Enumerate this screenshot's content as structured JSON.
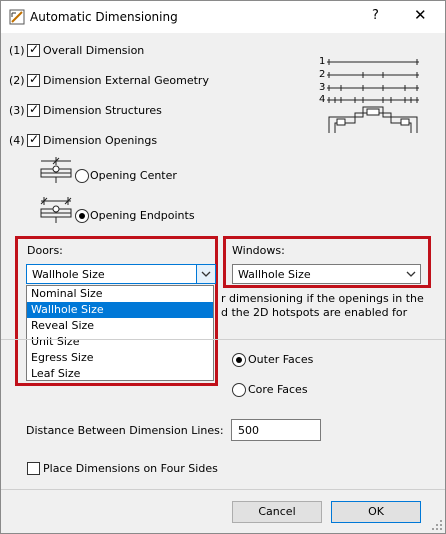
{
  "window": {
    "title": "Automatic Dimensioning",
    "help": "?",
    "close": "✕"
  },
  "options": [
    {
      "num": "(1)",
      "label": "Overall Dimension",
      "checked": true
    },
    {
      "num": "(2)",
      "label": "Dimension External Geometry",
      "checked": true
    },
    {
      "num": "(3)",
      "label": "Dimension Structures",
      "checked": true
    },
    {
      "num": "(4)",
      "label": "Dimension Openings",
      "checked": true
    }
  ],
  "preview_numbers": [
    "1",
    "2",
    "3",
    "4"
  ],
  "opening_mode": [
    {
      "label": "Opening Center",
      "selected": false
    },
    {
      "label": "Opening Endpoints",
      "selected": true
    }
  ],
  "doors": {
    "label": "Doors:",
    "value": "Wallhole Size",
    "list": [
      "Nominal Size",
      "Wallhole Size",
      "Reveal Size",
      "Unit Size",
      "Egress Size",
      "Leaf Size"
    ],
    "highlighted": "Wallhole Size"
  },
  "windows": {
    "label": "Windows:",
    "value": "Wallhole Size"
  },
  "hint_lines": [
    "r dimensioning if the openings in the",
    "d the 2D hotspots are enabled for"
  ],
  "faces": [
    {
      "label": "Outer Faces",
      "selected": true
    },
    {
      "label": "Core Faces",
      "selected": false
    }
  ],
  "distance": {
    "label": "Distance Between Dimension Lines:",
    "value": "500"
  },
  "four_sides": {
    "label": "Place Dimensions on Four Sides",
    "checked": false
  },
  "buttons": {
    "cancel": "Cancel",
    "ok": "OK"
  },
  "colors": {
    "highlight_box": "#c0101a",
    "selection": "#0078d7"
  }
}
